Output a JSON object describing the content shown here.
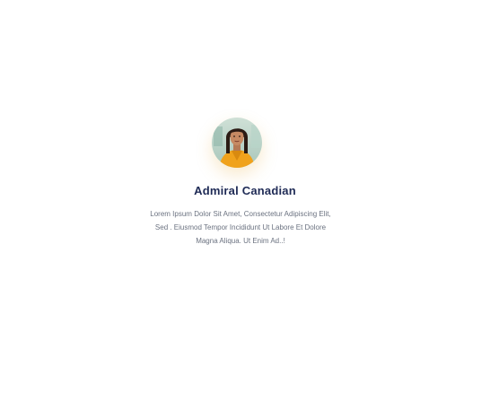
{
  "profile": {
    "name": "Admiral Canadian",
    "bio_lines": [
      "Lorem Ipsum Dolor Sit Amet, Consectetur Adipiscing Elit,",
      "Sed . Eiusmod Tempor Incididunt Ut Labore Et Dolore",
      "Magna Aliqua. Ut Enim Ad..!"
    ],
    "avatar_icon": "user-photo-avatar"
  },
  "colors": {
    "name": "#1e2a55",
    "bio": "#6b7280",
    "avatar_jacket": "#f0a21c",
    "background": "#ffffff"
  }
}
